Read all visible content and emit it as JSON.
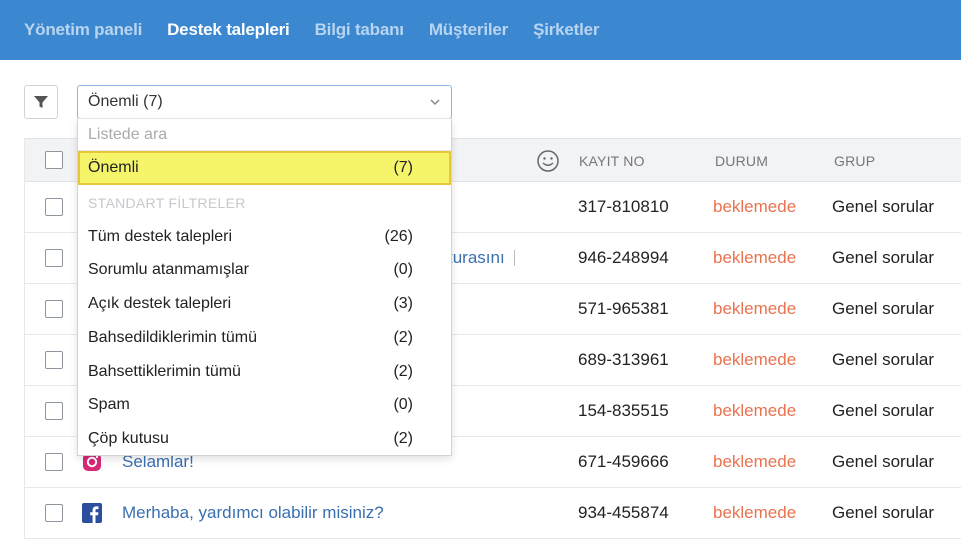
{
  "nav": {
    "items": [
      {
        "label": "Yönetim paneli",
        "active": false
      },
      {
        "label": "Destek talepleri",
        "active": true
      },
      {
        "label": "Bilgi tabanı",
        "active": false
      },
      {
        "label": "Müşteriler",
        "active": false
      },
      {
        "label": "Şirketler",
        "active": false
      }
    ]
  },
  "filter": {
    "selected": "Önemli (7)",
    "search_placeholder": "Listede ara",
    "highlighted": {
      "label": "Önemli",
      "count": "(7)"
    },
    "section_title": "STANDART FİLTRELER",
    "options": [
      {
        "label": "Tüm destek talepleri",
        "count": "(26)"
      },
      {
        "label": "Sorumlu atanmamışlar",
        "count": "(0)"
      },
      {
        "label": "Açık destek talepleri",
        "count": "(3)"
      },
      {
        "label": "Bahsedildiklerimin tümü",
        "count": "(2)"
      },
      {
        "label": "Bahsettiklerimin tümü",
        "count": "(2)"
      },
      {
        "label": "Spam",
        "count": "(0)"
      },
      {
        "label": "Çöp kutusu",
        "count": "(2)"
      }
    ]
  },
  "table": {
    "headers": {
      "record": "KAYIT NO",
      "status": "DURUM",
      "group": "GRUP"
    },
    "rows": [
      {
        "subject": "",
        "record": "317-810810",
        "status": "beklemede",
        "group": "Genel sorular"
      },
      {
        "subject": "turasını",
        "record": "946-248994",
        "status": "beklemede",
        "group": "Genel sorular"
      },
      {
        "subject": "",
        "record": "571-965381",
        "status": "beklemede",
        "group": "Genel sorular"
      },
      {
        "subject": "",
        "record": "689-313961",
        "status": "beklemede",
        "group": "Genel sorular"
      },
      {
        "subject": "",
        "record": "154-835515",
        "status": "beklemede",
        "group": "Genel sorular"
      },
      {
        "subject": "Selamlar!",
        "channel": "instagram-icon",
        "record": "671-459666",
        "status": "beklemede",
        "group": "Genel sorular"
      },
      {
        "subject": "Merhaba, yardımcı olabilir misiniz?",
        "channel": "facebook-icon",
        "record": "934-455874",
        "status": "beklemede",
        "group": "Genel sorular"
      }
    ]
  },
  "colors": {
    "nav_bg": "#3b87d0",
    "status": "#e8734f",
    "highlight": "#f6f468",
    "link": "#3a6fb0"
  }
}
